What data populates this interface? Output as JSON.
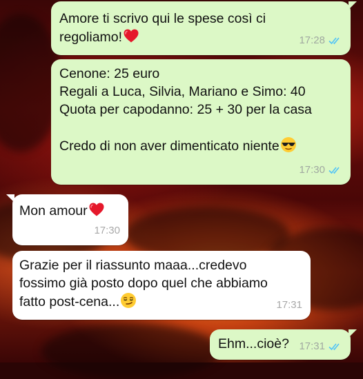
{
  "chat": {
    "messages": [
      {
        "direction": "outgoing",
        "lines": [
          "Amore ti scrivo qui le spese così ci",
          "regoliamo!"
        ],
        "emoji": "red-heart-icon",
        "time": "17:28",
        "read": true
      },
      {
        "direction": "outgoing",
        "lines": [
          "Cenone: 25 euro",
          "Regali a Luca, Silvia, Mariano e Simo: 40",
          "Quota per capodanno: 25 + 30 per la casa",
          "",
          "Credo di non aver dimenticato niente"
        ],
        "emoji": "sunglasses-face-icon",
        "time": "17:30",
        "read": true
      },
      {
        "direction": "incoming",
        "lines": [
          "Mon amour"
        ],
        "emoji": "red-heart-icon",
        "time": "17:30"
      },
      {
        "direction": "incoming",
        "lines": [
          "Grazie per il riassunto maaa...credevo",
          "fossimo già posto dopo quel che abbiamo",
          "fatto post-cena..."
        ],
        "emoji": "smirking-face-icon",
        "time": "17:31"
      },
      {
        "direction": "outgoing",
        "lines": [
          "Ehm...cioè?"
        ],
        "time": "17:31",
        "read": true
      }
    ]
  },
  "colors": {
    "outgoing_bubble": "#dcf8c6",
    "incoming_bubble": "#ffffff",
    "read_ticks": "#4fc3f7"
  }
}
